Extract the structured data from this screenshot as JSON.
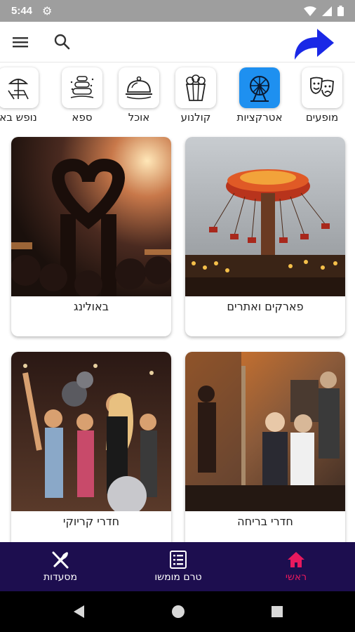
{
  "status_bar": {
    "time": "5:44"
  },
  "categories": [
    {
      "label": "מופעים",
      "icon": "theater-masks-icon",
      "active": false
    },
    {
      "label": "אטרקציות",
      "icon": "ferris-wheel-icon",
      "active": true
    },
    {
      "label": "קולנוע",
      "icon": "popcorn-icon",
      "active": false
    },
    {
      "label": "אוכל",
      "icon": "food-cloche-icon",
      "active": false
    },
    {
      "label": "ספא",
      "icon": "spa-stones-icon",
      "active": false
    },
    {
      "label": "נופש בא",
      "icon": "beach-chair-icon",
      "active": false
    }
  ],
  "cards": [
    {
      "title": "פארקים ואתרים",
      "image": "amusement-park-swing-ride"
    },
    {
      "title": "באולינג",
      "image": "concert-crowd-heart-hands"
    },
    {
      "title": "חדרי בריחה",
      "image": "escape-room-players"
    },
    {
      "title": "חדרי קריוקי",
      "image": "karaoke-party"
    }
  ],
  "bottom_nav": {
    "home": "ראשי",
    "menu": "טרם מומשו",
    "restaurants": "מסעדות"
  },
  "colors": {
    "accent": "#1e90f0",
    "nav_background": "#1d0e4f",
    "nav_active": "#e8195e",
    "share_arrow": "#1a28e6"
  }
}
